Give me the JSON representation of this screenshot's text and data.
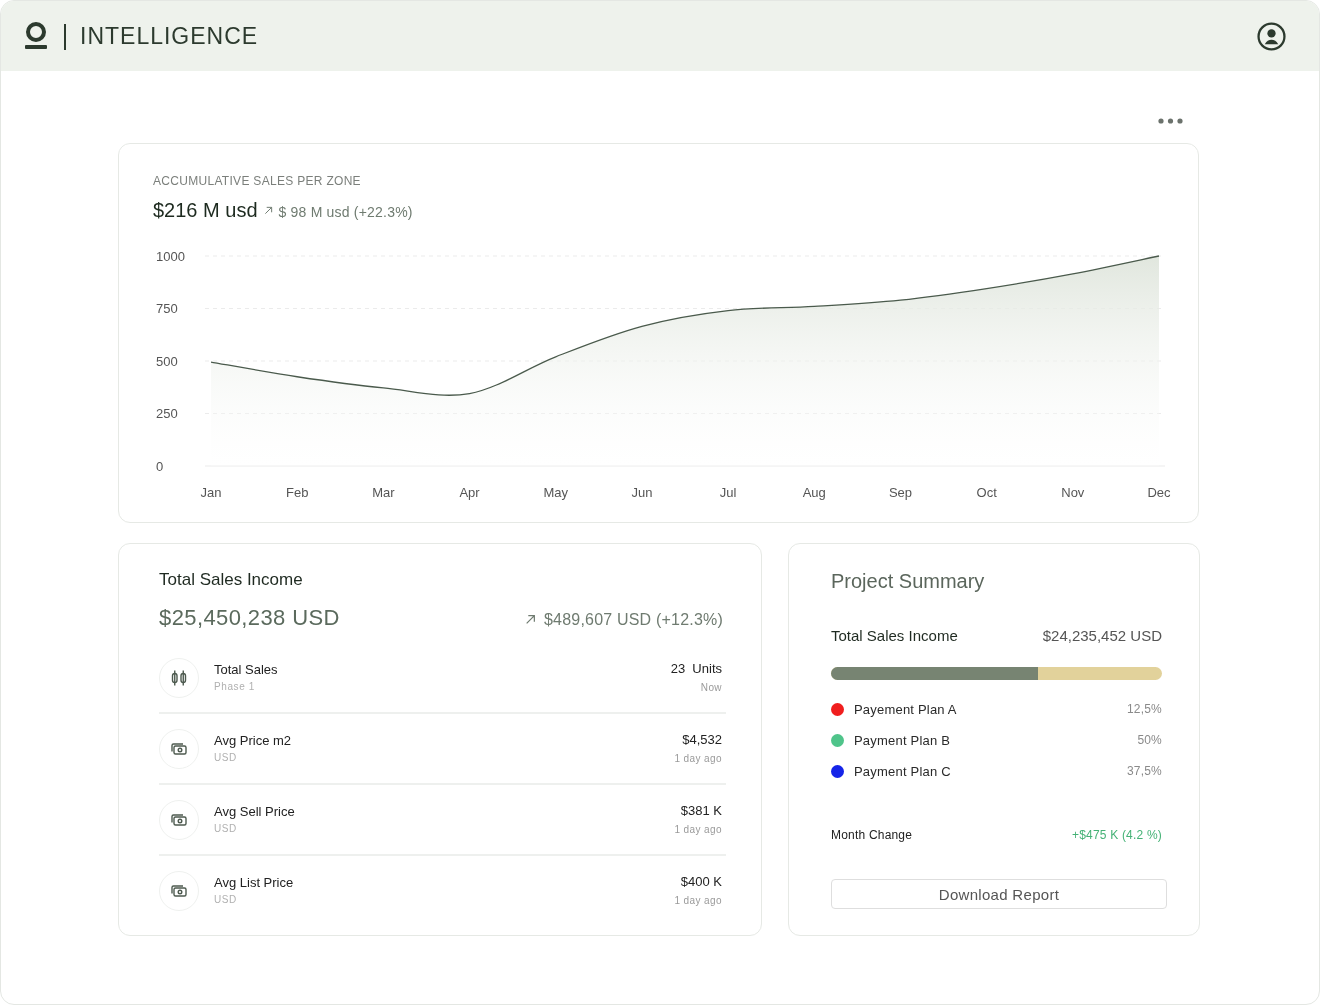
{
  "header": {
    "brand": "INTELLIGENCE"
  },
  "sales_chart": {
    "title": "ACCUMULATIVE SALES PER ZONE",
    "total": "$216 M usd",
    "change": "$ 98 M usd (+22.3%)",
    "chart_data": {
      "type": "area",
      "categories": [
        "Jan",
        "Feb",
        "Mar",
        "Apr",
        "May",
        "Jun",
        "Jul",
        "Aug",
        "Sep",
        "Oct",
        "Nov",
        "Dec"
      ],
      "series": [
        {
          "color": "#4a5a4c",
          "values": [
            495,
            425,
            372,
            345,
            520,
            665,
            740,
            760,
            790,
            845,
            915,
            1000
          ]
        }
      ],
      "ylim": [
        0,
        1000
      ],
      "yticks": [
        0,
        250,
        500,
        750,
        1000
      ],
      "grid": true
    }
  },
  "sales_income": {
    "title": "Total Sales Income",
    "total": "$25,450,238 USD",
    "change": "$489,607 USD (+12.3%)",
    "rows": [
      {
        "kind": "units",
        "label": "Total Sales",
        "sublabel": "Phase 1",
        "value": "23  Units",
        "time": "Now"
      },
      {
        "kind": "price",
        "label": "Avg Price m2",
        "sublabel": "USD",
        "value": "$4,532",
        "time": "1 day ago"
      },
      {
        "kind": "price",
        "label": "Avg Sell Price",
        "sublabel": "USD",
        "value": "$381 K",
        "time": "1 day ago"
      },
      {
        "kind": "price",
        "label": "Avg List Price",
        "sublabel": "USD",
        "value": "$400 K",
        "time": "1 day ago"
      }
    ]
  },
  "project_summary": {
    "title": "Project Summary",
    "income_label": "Total Sales Income",
    "income_value": "$24,235,452 USD",
    "progress": {
      "level": 0.625
    },
    "plans": [
      {
        "label": "Payement Plan A",
        "value": "12,5%",
        "color": "#f01e1e"
      },
      {
        "label": "Payment Plan B",
        "value": "50%",
        "color": "#4fc48a"
      },
      {
        "label": "Payment Plan C",
        "value": "37,5%",
        "color": "#1524e8"
      }
    ],
    "month_change": {
      "label": "Month Change",
      "value": "+$475 K (4.2 %)"
    },
    "button": "Download Report"
  }
}
